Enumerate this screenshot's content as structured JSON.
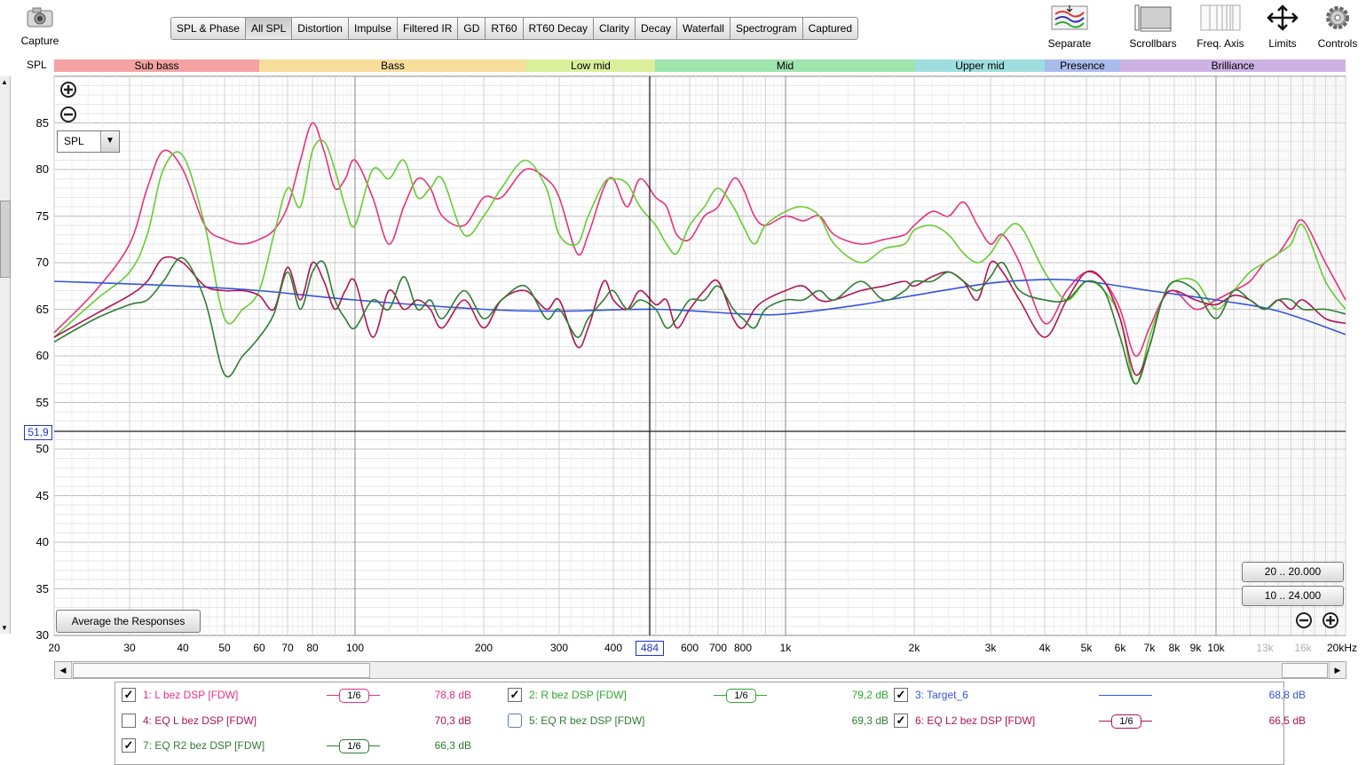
{
  "toolbar": {
    "capture_label": "Capture",
    "tabs": [
      "SPL & Phase",
      "All SPL",
      "Distortion",
      "Impulse",
      "Filtered IR",
      "GD",
      "RT60",
      "RT60 Decay",
      "Clarity",
      "Decay",
      "Waterfall",
      "Spectrogram",
      "Captured"
    ],
    "active_tab": "All SPL",
    "right_tools": [
      "Separate",
      "Scrollbars",
      "Freq. Axis",
      "Limits",
      "Controls"
    ]
  },
  "bands": [
    {
      "label": "Sub bass",
      "color": "#f4a2a2"
    },
    {
      "label": "Bass",
      "color": "#f7dd9a"
    },
    {
      "label": "Low mid",
      "color": "#d9ef9a"
    },
    {
      "label": "Mid",
      "color": "#9fe3ad"
    },
    {
      "label": "Upper mid",
      "color": "#9fdede"
    },
    {
      "label": "Presence",
      "color": "#a9bbeb"
    },
    {
      "label": "Brilliance",
      "color": "#cdb2e3"
    }
  ],
  "plot": {
    "y_axis_title": "SPL",
    "y_ticks": [
      "85",
      "80",
      "75",
      "70",
      "65",
      "60",
      "55",
      "50",
      "45",
      "40",
      "35",
      "30"
    ],
    "x_ticks": [
      "20",
      "30",
      "40",
      "50",
      "60",
      "70",
      "80",
      "100",
      "200",
      "300",
      "400",
      "600",
      "700",
      "800",
      "1k",
      "2k",
      "3k",
      "4k",
      "5k",
      "6k",
      "7k",
      "8k",
      "9k",
      "10k",
      "13k",
      "16k",
      "20kHz"
    ],
    "cursor_y_label": "51,9",
    "cursor_x_label": "484",
    "dropdown_value": "SPL",
    "avg_button": "Average the Responses",
    "range_btn_1": "20 .. 20.000",
    "range_btn_2": "10 .. 24.000"
  },
  "chart_data": {
    "type": "line",
    "x_scale": "log",
    "xlim": [
      20,
      20000
    ],
    "ylim": [
      30,
      90
    ],
    "xlabel": "",
    "ylabel": "SPL",
    "cursor": {
      "x": 484,
      "y": 51.9
    },
    "series": [
      {
        "name": "1: L bez DSP [FDW]",
        "color": "#e8307a",
        "x": [
          20,
          25,
          30,
          33,
          36,
          40,
          45,
          50,
          55,
          60,
          65,
          70,
          75,
          80,
          85,
          90,
          95,
          100,
          110,
          120,
          130,
          140,
          150,
          160,
          180,
          200,
          220,
          250,
          280,
          300,
          330,
          350,
          380,
          400,
          430,
          460,
          500,
          530,
          560,
          600,
          650,
          700,
          760,
          800,
          850,
          900,
          1000,
          1100,
          1200,
          1300,
          1500,
          1700,
          1900,
          2000,
          2200,
          2400,
          2600,
          2800,
          3000,
          3200,
          3500,
          4000,
          4500,
          5000,
          5500,
          6000,
          6500,
          7000,
          7500,
          8000,
          9000,
          10000,
          11000,
          12000,
          13000,
          14000,
          15000,
          16000,
          18000,
          20000
        ],
        "y": [
          62.5,
          67,
          72,
          78,
          82,
          80,
          74,
          72.5,
          72,
          72.5,
          73.5,
          76,
          81,
          85,
          82,
          78,
          79,
          81,
          77,
          72,
          76,
          79,
          78,
          75,
          74,
          77,
          77,
          80,
          79,
          77,
          71,
          73,
          78,
          79,
          76,
          79,
          77,
          76,
          73,
          72.5,
          75,
          76,
          79,
          78,
          75,
          74,
          75,
          74.5,
          75,
          73,
          72,
          72.5,
          73,
          74,
          75.5,
          75,
          76.5,
          74,
          72,
          73,
          70,
          63.5,
          67,
          69,
          68,
          65,
          60,
          63,
          66,
          67,
          65,
          66,
          67,
          68,
          70,
          71,
          73,
          74.5,
          70,
          66
        ]
      },
      {
        "name": "2: R bez DSP [FDW]",
        "color": "#66cc33",
        "x": [
          20,
          25,
          30,
          33,
          36,
          40,
          45,
          50,
          55,
          60,
          65,
          70,
          75,
          80,
          85,
          90,
          95,
          100,
          110,
          120,
          130,
          140,
          150,
          160,
          180,
          200,
          220,
          250,
          280,
          300,
          330,
          350,
          380,
          400,
          430,
          460,
          500,
          530,
          560,
          600,
          650,
          700,
          760,
          800,
          850,
          900,
          1000,
          1100,
          1200,
          1300,
          1500,
          1700,
          1900,
          2000,
          2200,
          2400,
          2600,
          2800,
          3000,
          3200,
          3500,
          4000,
          4500,
          5000,
          5500,
          6000,
          6500,
          7000,
          7500,
          8000,
          9000,
          10000,
          11000,
          12000,
          13000,
          14000,
          15000,
          16000,
          18000,
          20000
        ],
        "y": [
          62,
          66,
          69,
          73,
          80,
          81.5,
          74,
          64,
          65,
          67,
          73,
          78,
          76,
          82,
          83,
          80,
          76,
          74,
          80,
          79,
          81,
          77,
          78,
          79,
          73,
          75,
          78,
          81,
          78,
          73,
          72,
          75,
          78.5,
          79,
          78.5,
          76,
          74,
          72,
          71,
          74,
          76,
          78,
          76,
          74,
          72,
          74,
          75.5,
          76,
          75,
          72,
          70,
          71.5,
          72,
          73.5,
          74,
          73,
          71,
          70,
          71,
          73,
          74,
          69,
          66,
          68,
          67,
          64,
          57,
          62,
          66,
          68,
          68,
          65,
          67,
          69,
          70,
          71,
          72,
          74,
          68,
          65
        ]
      },
      {
        "name": "3: Target_6",
        "color": "#3355dd",
        "x": [
          20,
          40,
          60,
          100,
          200,
          300,
          500,
          800,
          1000,
          1500,
          2000,
          3000,
          4000,
          5000,
          7000,
          10000,
          14000,
          20000
        ],
        "y": [
          68,
          67.5,
          67,
          66,
          65,
          64.8,
          65,
          64.5,
          64.5,
          65.5,
          66.5,
          67.8,
          68.2,
          68,
          67,
          66,
          64.8,
          62.3
        ]
      },
      {
        "name": "6: EQ L2 bez DSP [FDW]",
        "color": "#b01555",
        "x": [
          20,
          25,
          30,
          33,
          36,
          40,
          45,
          50,
          55,
          60,
          65,
          70,
          75,
          80,
          85,
          90,
          95,
          100,
          110,
          120,
          130,
          140,
          150,
          160,
          180,
          200,
          220,
          250,
          280,
          300,
          330,
          350,
          380,
          400,
          430,
          460,
          500,
          530,
          560,
          600,
          650,
          700,
          760,
          800,
          850,
          900,
          1000,
          1100,
          1200,
          1300,
          1500,
          1700,
          1900,
          2000,
          2200,
          2400,
          2600,
          2800,
          3000,
          3200,
          3500,
          4000,
          4500,
          5000,
          5500,
          6000,
          6500,
          7000,
          7500,
          8000,
          9000,
          10000,
          11000,
          12000,
          13000,
          14000,
          15000,
          16000,
          18000,
          20000
        ],
        "y": [
          62,
          64.5,
          66.5,
          68,
          70.5,
          70,
          67.5,
          67,
          67,
          66.5,
          65,
          69.5,
          66,
          70,
          68,
          65,
          67,
          68,
          62,
          67,
          65,
          66,
          65,
          63,
          66,
          63,
          66,
          67,
          65,
          66,
          61,
          63,
          68,
          66,
          65,
          67,
          65.5,
          66,
          63,
          65,
          67,
          68,
          64,
          63,
          65,
          66,
          67,
          67.5,
          66,
          66,
          67,
          67.5,
          68,
          67.5,
          68.5,
          69,
          68,
          66,
          70,
          69,
          66,
          62,
          66,
          69,
          68,
          64,
          58,
          61,
          66,
          67,
          66,
          65.5,
          66.5,
          66,
          65,
          66,
          65,
          66,
          64,
          63.5
        ]
      },
      {
        "name": "7: EQ R2 bez DSP [FDW]",
        "color": "#2e7d32",
        "x": [
          20,
          25,
          30,
          33,
          36,
          40,
          45,
          50,
          55,
          60,
          65,
          70,
          75,
          80,
          85,
          90,
          95,
          100,
          110,
          120,
          130,
          140,
          150,
          160,
          180,
          200,
          220,
          250,
          280,
          300,
          330,
          350,
          380,
          400,
          430,
          460,
          500,
          530,
          560,
          600,
          650,
          700,
          760,
          800,
          850,
          900,
          1000,
          1100,
          1200,
          1300,
          1500,
          1700,
          1900,
          2000,
          2200,
          2400,
          2600,
          2800,
          3000,
          3200,
          3500,
          4000,
          4500,
          5000,
          5500,
          6000,
          6500,
          7000,
          7500,
          8000,
          9000,
          10000,
          11000,
          12000,
          13000,
          14000,
          15000,
          16000,
          18000,
          20000
        ],
        "y": [
          61.5,
          64,
          65.5,
          66,
          68,
          70.5,
          66,
          58,
          60,
          62,
          64.5,
          69,
          65,
          69,
          70,
          66,
          64,
          63,
          66,
          65,
          68.5,
          65,
          66,
          64,
          67,
          64,
          66,
          67.5,
          64,
          65,
          62,
          64,
          66,
          67,
          65,
          66,
          65,
          63,
          64,
          66,
          66,
          67.5,
          65,
          64,
          63,
          65,
          66,
          66,
          67,
          66,
          68,
          66,
          67,
          68,
          68,
          69,
          68,
          67,
          68.5,
          70,
          67,
          66,
          66,
          68,
          67,
          62,
          57,
          61,
          66,
          68,
          67,
          64,
          67,
          66,
          65,
          66,
          66,
          65,
          65,
          64.5
        ]
      }
    ]
  },
  "legend": [
    {
      "checked": true,
      "name": "1: L bez DSP [FDW]",
      "color": "#e8307a",
      "smoothing": "1/6",
      "value": "78,8 dB"
    },
    {
      "checked": true,
      "name": "2: R bez DSP [FDW]",
      "color": "#2ea82e",
      "smoothing": "1/6",
      "value": "79,2 dB"
    },
    {
      "checked": true,
      "name": "3: Target_6",
      "color": "#3355dd",
      "smoothing": "",
      "value": "68,8 dB"
    },
    {
      "checked": false,
      "name": "4: EQ L bez DSP [FDW]",
      "color": "#b01555",
      "smoothing": "",
      "value": "70,3 dB"
    },
    {
      "checked": false,
      "name": "5: EQ R bez DSP [FDW]",
      "color": "#2e7d32",
      "smoothing": "",
      "value": "69,3 dB"
    },
    {
      "checked": true,
      "name": "6: EQ L2 bez DSP [FDW]",
      "color": "#b01555",
      "smoothing": "1/6",
      "value": "66,5 dB"
    },
    {
      "checked": true,
      "name": "7: EQ R2 bez DSP [FDW]",
      "color": "#2e7d32",
      "smoothing": "1/6",
      "value": "66,3 dB"
    }
  ]
}
